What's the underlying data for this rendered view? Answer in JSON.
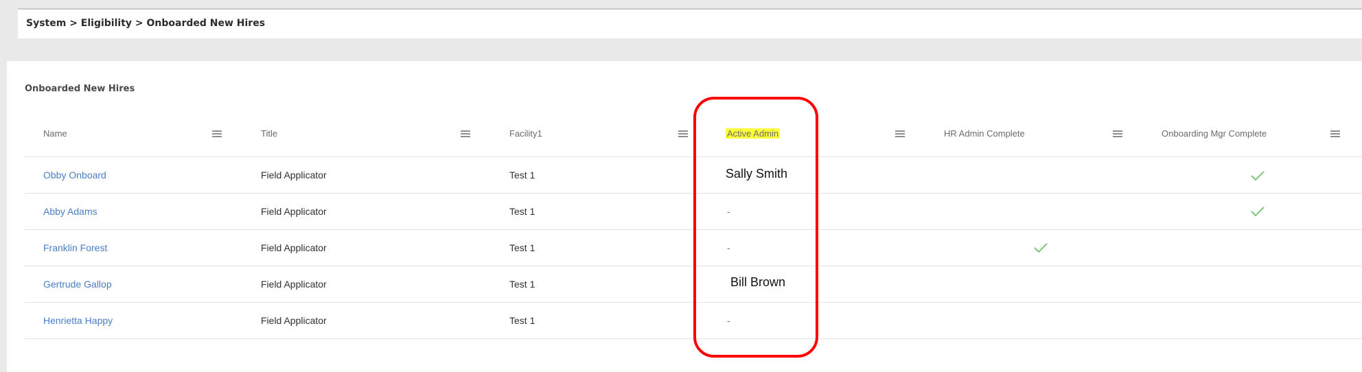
{
  "breadcrumb": "System > Eligibility > Onboarded New Hires",
  "panel_title": "Onboarded New Hires",
  "columns": [
    {
      "label": "Name",
      "highlighted": false
    },
    {
      "label": "Title",
      "highlighted": false
    },
    {
      "label": "Facility1",
      "highlighted": false
    },
    {
      "label": "Active Admin",
      "highlighted": true
    },
    {
      "label": "HR Admin Complete",
      "highlighted": false
    },
    {
      "label": "Onboarding Mgr Complete",
      "highlighted": false
    }
  ],
  "rows": [
    {
      "name": "Obby Onboard",
      "title": "Field Applicator",
      "facility": "Test 1",
      "active_admin": "Sally Smith",
      "hr_admin_complete": false,
      "onboarding_mgr_complete": true
    },
    {
      "name": "Abby Adams",
      "title": "Field Applicator",
      "facility": "Test 1",
      "active_admin": "-",
      "hr_admin_complete": false,
      "onboarding_mgr_complete": true
    },
    {
      "name": "Franklin Forest",
      "title": "Field Applicator",
      "facility": "Test 1",
      "active_admin": "-",
      "hr_admin_complete": true,
      "onboarding_mgr_complete": false
    },
    {
      "name": "Gertrude Gallop",
      "title": "Field Applicator",
      "facility": "Test 1",
      "active_admin": "Bill Brown",
      "hr_admin_complete": false,
      "onboarding_mgr_complete": false
    },
    {
      "name": "Henrietta Happy",
      "title": "Field Applicator",
      "facility": "Test 1",
      "active_admin": "-",
      "hr_admin_complete": false,
      "onboarding_mgr_complete": false
    }
  ],
  "colors": {
    "link": "#4a7ec7",
    "check": "#7dc47d",
    "highlight": "#ffff3a",
    "annotation": "#ff0000"
  }
}
